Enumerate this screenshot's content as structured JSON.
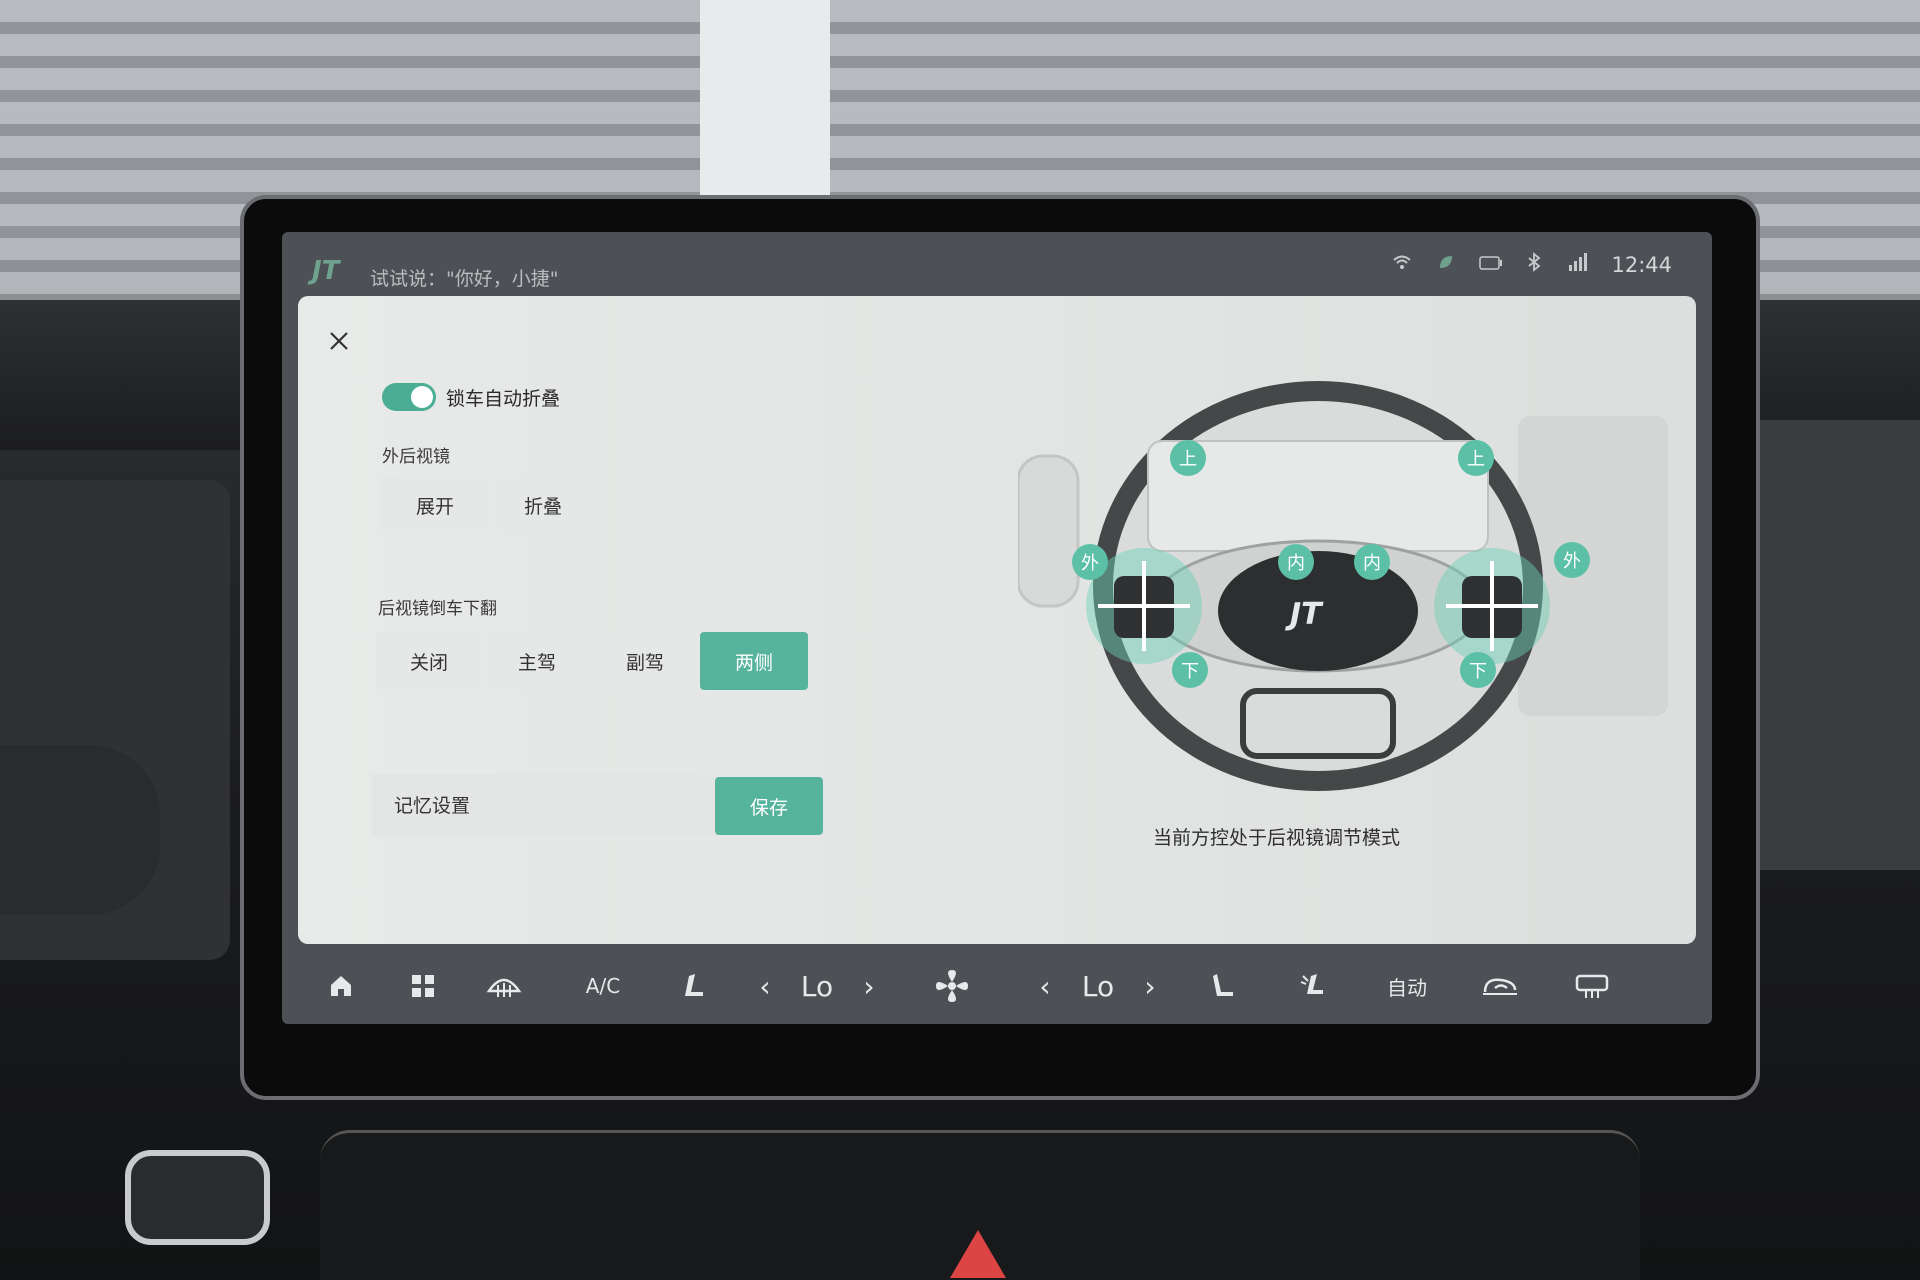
{
  "status_bar": {
    "voice_hint": "试试说：\"你好，小捷\"",
    "time": "12:44",
    "icons": [
      "wifi-icon",
      "leaf-icon",
      "battery-icon",
      "bluetooth-icon",
      "signal-icon"
    ]
  },
  "panel": {
    "lock_fold": {
      "label": "锁车自动折叠",
      "enabled": true
    },
    "exterior_mirror": {
      "title": "外后视镜",
      "options": [
        "展开",
        "折叠"
      ]
    },
    "reverse_tilt": {
      "title": "后视镜倒车下翻",
      "options": [
        "关闭",
        "主驾",
        "副驾",
        "两侧"
      ],
      "selected": "两侧"
    },
    "memory": {
      "label": "记忆设置",
      "save_label": "保存"
    },
    "wheel_labels": {
      "up_left": "上",
      "up_right": "上",
      "out_left": "外",
      "out_right": "外",
      "in_left": "内",
      "in_right": "内",
      "down_left": "下",
      "down_right": "下"
    },
    "mode_text": "当前方控处于后视镜调节模式"
  },
  "dock": {
    "ac": "A/C",
    "left_temp": "Lo",
    "right_temp": "Lo",
    "auto": "自动",
    "icons": [
      "home-icon",
      "apps-icon",
      "front-defrost-icon",
      "seat-heat-icon",
      "fan-icon",
      "seat-icon",
      "seat-vent-icon",
      "recirculation-icon",
      "rear-defrost-icon"
    ]
  },
  "colors": {
    "accent": "#56b39c",
    "panel_bg": "#e6e8e7"
  }
}
